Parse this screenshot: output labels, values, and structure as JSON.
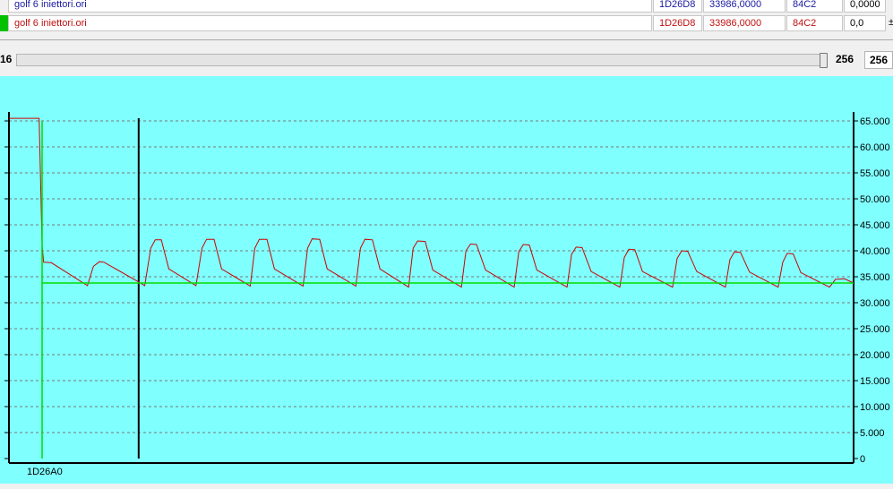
{
  "rows": [
    {
      "file": "golf 6 iniettori.ori",
      "address": "1D26D8",
      "value": "33986,0000",
      "code": "84C2",
      "extra": "0,0000",
      "color": "#1a1aa0",
      "selector_color": ""
    },
    {
      "file": "golf 6 iniettori.ori",
      "address": "1D26D8",
      "value": "33986,0000",
      "code": "84C2",
      "extra": "0,0",
      "color": "#c01010",
      "selector_color": "#00c000",
      "trailing": "±"
    }
  ],
  "slider": {
    "left_label": "16",
    "value_label": "256",
    "box_value": "256",
    "fraction": 1.0
  },
  "chart_data": {
    "type": "line",
    "x_start_label": "1D26A0",
    "x_range": [
      0,
      280
    ],
    "ylim": [
      0,
      65000
    ],
    "y_ticks": [
      "0",
      "5.000",
      "10.000",
      "15.000",
      "20.000",
      "25.000",
      "30.000",
      "35.000",
      "40.000",
      "45.000",
      "50.000",
      "55.000",
      "60.000",
      "65.000"
    ],
    "y_tick_values": [
      0,
      5000,
      10000,
      15000,
      20000,
      25000,
      30000,
      35000,
      40000,
      45000,
      50000,
      55000,
      60000,
      65000
    ],
    "grid": true,
    "cursor_x": 43,
    "series": [
      {
        "color": "#cc0000",
        "points": [
          [
            0,
            65500
          ],
          [
            10,
            65500
          ],
          [
            11,
            41000
          ],
          [
            11.5,
            37800
          ],
          [
            14,
            37700
          ],
          [
            26,
            33300
          ],
          [
            28,
            37000
          ],
          [
            30,
            37900
          ],
          [
            31.5,
            37800
          ],
          [
            43,
            34000
          ],
          [
            45,
            33300
          ],
          [
            47,
            40500
          ],
          [
            48.5,
            42100
          ],
          [
            50.5,
            42100
          ],
          [
            53,
            36500
          ],
          [
            62,
            33300
          ],
          [
            64,
            40500
          ],
          [
            65.5,
            42200
          ],
          [
            68,
            42200
          ],
          [
            70.5,
            36500
          ],
          [
            80,
            33200
          ],
          [
            81.5,
            40500
          ],
          [
            83,
            42200
          ],
          [
            85.5,
            42200
          ],
          [
            88,
            36500
          ],
          [
            97.5,
            33200
          ],
          [
            99,
            40500
          ],
          [
            100.5,
            42300
          ],
          [
            103,
            42200
          ],
          [
            105.5,
            36500
          ],
          [
            115,
            33200
          ],
          [
            116.5,
            40500
          ],
          [
            118,
            42200
          ],
          [
            120.5,
            42100
          ],
          [
            123,
            36500
          ],
          [
            132.5,
            33000
          ],
          [
            134,
            40500
          ],
          [
            135.5,
            41900
          ],
          [
            138,
            41800
          ],
          [
            140.5,
            36300
          ],
          [
            150,
            33000
          ],
          [
            151.5,
            40000
          ],
          [
            153,
            41300
          ],
          [
            155,
            41200
          ],
          [
            158,
            36300
          ],
          [
            167.5,
            33000
          ],
          [
            169,
            39800
          ],
          [
            170.5,
            41200
          ],
          [
            172.5,
            41100
          ],
          [
            175,
            36300
          ],
          [
            185,
            33000
          ],
          [
            186.5,
            39300
          ],
          [
            188,
            40700
          ],
          [
            190,
            40600
          ],
          [
            193,
            36000
          ],
          [
            202.5,
            33000
          ],
          [
            204,
            38700
          ],
          [
            205.5,
            40300
          ],
          [
            207.5,
            40200
          ],
          [
            210,
            36000
          ],
          [
            220,
            33000
          ],
          [
            221.5,
            38500
          ],
          [
            223,
            40000
          ],
          [
            225,
            39900
          ],
          [
            228,
            36000
          ],
          [
            237.5,
            33000
          ],
          [
            239,
            38300
          ],
          [
            240.5,
            39800
          ],
          [
            242.5,
            39700
          ],
          [
            245.5,
            35900
          ],
          [
            255,
            33000
          ],
          [
            256.5,
            37800
          ],
          [
            258,
            39500
          ],
          [
            260,
            39400
          ],
          [
            262.5,
            35800
          ],
          [
            272,
            33000
          ],
          [
            274,
            34500
          ],
          [
            277,
            34600
          ],
          [
            280,
            33800
          ]
        ]
      },
      {
        "color": "#00dd00",
        "points": [
          [
            11,
            0
          ],
          [
            11,
            65000
          ],
          [
            11,
            33800
          ],
          [
            280,
            33800
          ]
        ]
      }
    ]
  }
}
